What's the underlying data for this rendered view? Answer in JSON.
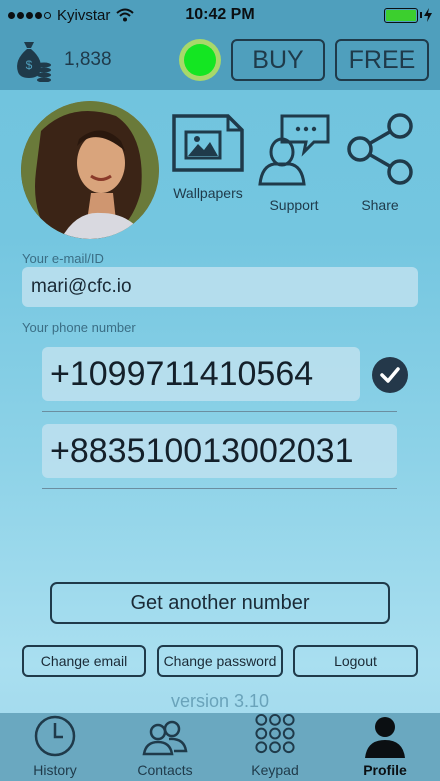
{
  "status_bar": {
    "carrier": "Kyivstar",
    "time": "10:42 PM",
    "signal_bars": 4,
    "battery_level": 1.0
  },
  "topbar": {
    "coins": "1,838",
    "online_color": "#14e622",
    "buy_label": "BUY",
    "free_label": "FREE"
  },
  "actions": {
    "wallpapers": "Wallpapers",
    "support": "Support",
    "share": "Share"
  },
  "form": {
    "email_label": "Your e-mail/ID",
    "email_value": "mari@cfc.io",
    "phone_label": "Your phone number",
    "phones": [
      "+1099711410564",
      "+883510013002031"
    ]
  },
  "buttons": {
    "get_number": "Get another number",
    "change_email": "Change email",
    "change_password": "Change password",
    "logout": "Logout"
  },
  "version": "version 3.10",
  "tabs": [
    {
      "label": "History",
      "icon": "clock-icon"
    },
    {
      "label": "Contacts",
      "icon": "contacts-icon"
    },
    {
      "label": "Keypad",
      "icon": "keypad-icon"
    },
    {
      "label": "Profile",
      "icon": "profile-icon",
      "active": true
    }
  ]
}
